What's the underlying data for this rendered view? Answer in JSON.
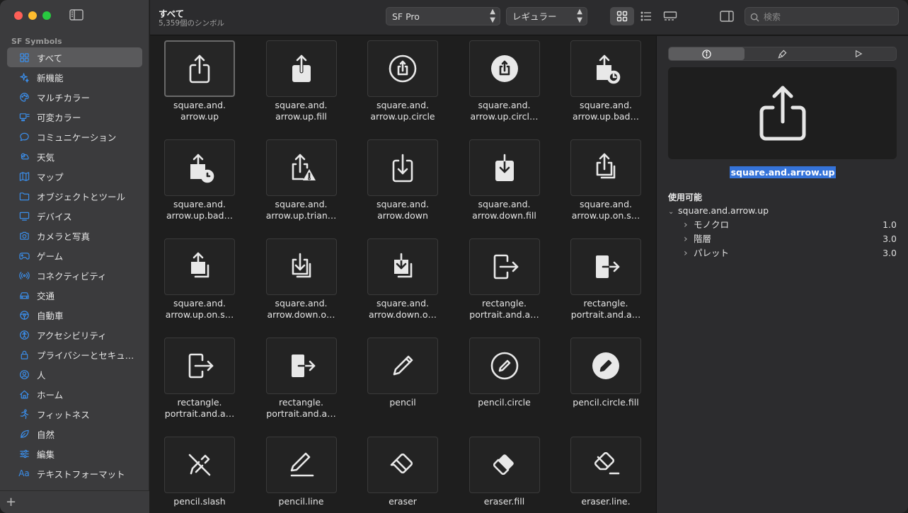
{
  "sidebar": {
    "section_title": "SF Symbols",
    "items": [
      {
        "label": "すべて",
        "icon": "grid-icon"
      },
      {
        "label": "新機能",
        "icon": "sparkles-icon"
      },
      {
        "label": "マルチカラー",
        "icon": "paintpalette-icon"
      },
      {
        "label": "可変カラー",
        "icon": "variable-color-icon"
      },
      {
        "label": "コミュニケーション",
        "icon": "message-icon"
      },
      {
        "label": "天気",
        "icon": "cloud-sun-icon"
      },
      {
        "label": "マップ",
        "icon": "map-icon"
      },
      {
        "label": "オブジェクトとツール",
        "icon": "folder-icon"
      },
      {
        "label": "デバイス",
        "icon": "display-icon"
      },
      {
        "label": "カメラと写真",
        "icon": "camera-icon"
      },
      {
        "label": "ゲーム",
        "icon": "gamecontroller-icon"
      },
      {
        "label": "コネクティビティ",
        "icon": "antenna-icon"
      },
      {
        "label": "交通",
        "icon": "car-icon"
      },
      {
        "label": "自動車",
        "icon": "steeringwheel-icon"
      },
      {
        "label": "アクセシビリティ",
        "icon": "accessibility-icon"
      },
      {
        "label": "プライバシーとセキュ…",
        "icon": "lock-icon"
      },
      {
        "label": "人",
        "icon": "person-icon"
      },
      {
        "label": "ホーム",
        "icon": "house-icon"
      },
      {
        "label": "フィットネス",
        "icon": "figure-run-icon"
      },
      {
        "label": "自然",
        "icon": "leaf-icon"
      },
      {
        "label": "編集",
        "icon": "slider-icon"
      },
      {
        "label": "テキストフォーマット",
        "icon": "textformat-icon"
      }
    ],
    "add_label": "+"
  },
  "toolbar": {
    "title": "すべて",
    "subtitle": "5,359個のシンボル",
    "font_select": "SF Pro",
    "weight_select": "レギュラー",
    "search_placeholder": "検索"
  },
  "symbols": [
    {
      "name": "square.and.\narrow.up",
      "glyph": "share"
    },
    {
      "name": "square.and.\narrow.up.fill",
      "glyph": "share-fill"
    },
    {
      "name": "square.and.\narrow.up.circle",
      "glyph": "share-circle"
    },
    {
      "name": "square.and.\narrow.up.circl…",
      "glyph": "share-circle-fill"
    },
    {
      "name": "square.and.\narrow.up.bad…",
      "glyph": "share-badge"
    },
    {
      "name": "square.and.\narrow.up.bad…",
      "glyph": "share-badge-fill"
    },
    {
      "name": "square.and.\narrow.up.trian…",
      "glyph": "share-triangle"
    },
    {
      "name": "square.and.\narrow.down",
      "glyph": "download"
    },
    {
      "name": "square.and.\narrow.down.fill",
      "glyph": "download-fill"
    },
    {
      "name": "square.and.\narrow.up.on.s…",
      "glyph": "share-stack"
    },
    {
      "name": "square.and.\narrow.up.on.s…",
      "glyph": "share-stack-fill"
    },
    {
      "name": "square.and.\narrow.down.o…",
      "glyph": "download-stack"
    },
    {
      "name": "square.and.\narrow.down.o…",
      "glyph": "download-stack-fill"
    },
    {
      "name": "rectangle.\nportrait.and.a…",
      "glyph": "door-arrow"
    },
    {
      "name": "rectangle.\nportrait.and.a…",
      "glyph": "door-arrow-fill"
    },
    {
      "name": "rectangle.\nportrait.and.a…",
      "glyph": "door-arrow"
    },
    {
      "name": "rectangle.\nportrait.and.a…",
      "glyph": "door-arrow-fill"
    },
    {
      "name": "pencil",
      "glyph": "pencil"
    },
    {
      "name": "pencil.circle",
      "glyph": "pencil-circle"
    },
    {
      "name": "pencil.circle.fill",
      "glyph": "pencil-circle-fill"
    },
    {
      "name": "pencil.slash",
      "glyph": "pencil-slash"
    },
    {
      "name": "pencil.line",
      "glyph": "pencil-line"
    },
    {
      "name": "eraser",
      "glyph": "eraser"
    },
    {
      "name": "eraser.fill",
      "glyph": "eraser-fill"
    },
    {
      "name": "eraser.line.",
      "glyph": "eraser-line"
    }
  ],
  "inspector": {
    "selected_name": "square.and.arrow.up",
    "available_label": "使用可能",
    "tree_root": "square.and.arrow.up",
    "tree_rows": [
      {
        "label": "モノクロ",
        "value": "1.0"
      },
      {
        "label": "階層",
        "value": "3.0"
      },
      {
        "label": "パレット",
        "value": "3.0"
      }
    ]
  },
  "colors": {
    "accent": "#3b8eea",
    "selection": "#3573d9"
  }
}
